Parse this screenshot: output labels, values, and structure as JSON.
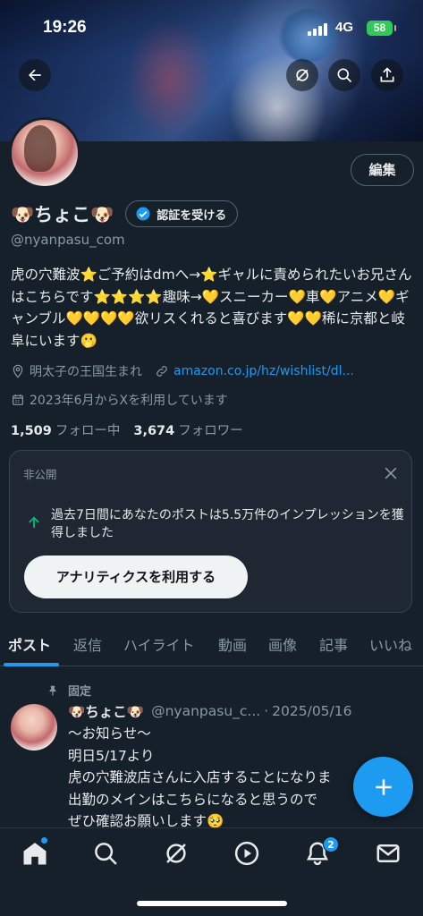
{
  "status_bar": {
    "time": "19:26",
    "network": "4G",
    "battery": "58"
  },
  "header": {
    "back_icon": "arrow-left-icon",
    "actions": [
      "grok-icon",
      "search-icon",
      "share-icon"
    ]
  },
  "profile": {
    "display_name": "🐶ちょこ🐶",
    "verify_label": "認証を受ける",
    "handle": "@nyanpasu_com",
    "edit_label": "編集",
    "bio": "虎の穴難波⭐ご予約はdmへ→⭐ギャルに責められたいお兄さんはこちらです⭐⭐⭐⭐趣味→💛スニーカー💛車💛アニメ💛ギャンブル💛💛💛💛欲リスくれると喜びます💛💛稀に京都と岐阜にいます🫢",
    "location": "明太子の王国生まれ",
    "website": "amazon.co.jp/hz/wishlist/dl...",
    "joined": "2023年6月からXを利用しています",
    "following_count": "1,509",
    "following_label": "フォロー中",
    "followers_count": "3,674",
    "followers_label": "フォロワー"
  },
  "analytics_card": {
    "private_label": "非公開",
    "message": "過去7日間にあなたのポストは5.5万件のインプレッションを獲得しました",
    "button_label": "アナリティクスを利用する"
  },
  "tabs": [
    "ポスト",
    "返信",
    "ハイライト",
    "動画",
    "画像",
    "記事",
    "いいね"
  ],
  "active_tab": "ポスト",
  "pinned_post": {
    "pinned_label": "固定",
    "author_name": "🐶ちょこ🐶",
    "author_handle": "@nyanpasu_c...",
    "separator": "·",
    "date": "2025/05/16",
    "lines": [
      "〜お知らせ〜",
      "明日5/17より",
      "虎の穴難波店さんに入店することになりま",
      "出勤のメインはこちらになると思うので",
      "ぜひ確認お願いします🥺"
    ]
  },
  "bottom_nav": {
    "items": [
      "home-icon",
      "search-icon",
      "grok-icon",
      "play-icon",
      "notifications-icon",
      "messages-icon"
    ],
    "notification_badge": "2"
  },
  "colors": {
    "accent": "#1d9bf0",
    "background": "#15202b",
    "muted": "#8b98a5",
    "text": "#e7e9ea"
  }
}
